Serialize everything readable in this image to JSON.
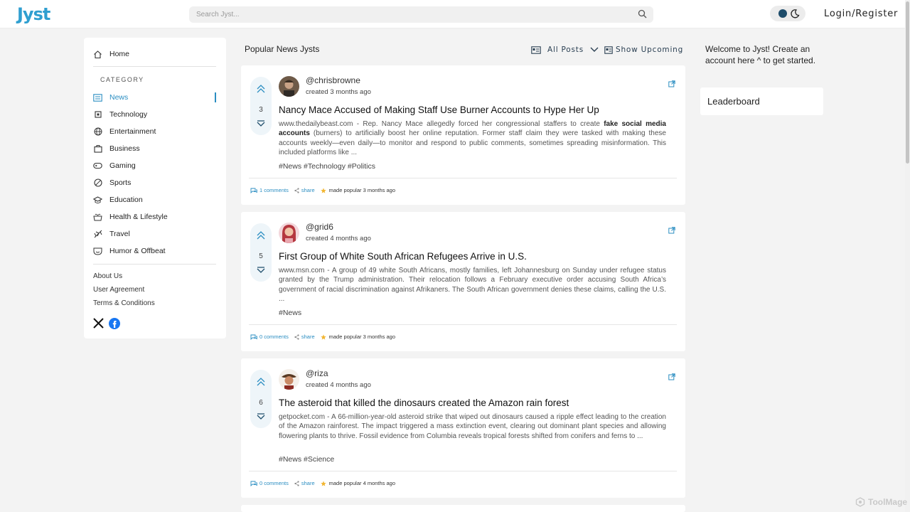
{
  "header": {
    "logo": "Jyst",
    "search_placeholder": "Search Jyst...",
    "login": "Login/Register"
  },
  "sidebar": {
    "home": "Home",
    "category_label": "CATEGORY",
    "categories": [
      {
        "label": "News",
        "icon": "newspaper-icon",
        "active": true
      },
      {
        "label": "Technology",
        "icon": "chip-icon"
      },
      {
        "label": "Entertainment",
        "icon": "globe-icon"
      },
      {
        "label": "Business",
        "icon": "briefcase-icon"
      },
      {
        "label": "Gaming",
        "icon": "gamepad-icon"
      },
      {
        "label": "Sports",
        "icon": "ball-icon"
      },
      {
        "label": "Education",
        "icon": "graduation-cap-icon"
      },
      {
        "label": "Health & Lifestyle",
        "icon": "heart-pot-icon"
      },
      {
        "label": "Travel",
        "icon": "plane-icon"
      },
      {
        "label": "Humor & Offbeat",
        "icon": "smile-icon"
      }
    ],
    "about": "About Us",
    "agreement": "User Agreement",
    "terms": "Terms & Conditions"
  },
  "main": {
    "title": "Popular News Jysts",
    "filter_label": "All Posts",
    "upcoming_label": "Show Upcoming",
    "posts": [
      {
        "votes": "3",
        "username": "@chrisbrowne",
        "created": "created 3 months ago",
        "title": "Nancy Mace Accused of Making Staff Use Burner Accounts to Hype Her Up",
        "body_pre": "www.thedailybeast.com - Rep. Nancy Mace allegedly forced her congressional staffers to create ",
        "body_bold": "fake social media accounts",
        "body_post": " (burners) to artificially boost her online reputation. Former staff claim they were tasked with making these accounts weekly—even daily—to monitor and respond to public comments, sometimes spreading misinformation. This included platforms like ...",
        "tags": "#News #Technology #Politics",
        "comments": "1 comments",
        "share": "share",
        "popular": "made popular 3 months ago"
      },
      {
        "votes": "5",
        "username": "@grid6",
        "created": "created 4 months ago",
        "title": "First Group of White South African Refugees Arrive in U.S.",
        "body_pre": "www.msn.com - A group of 49 white South Africans, mostly families, left Johannesburg on Sunday under refugee status granted by the Trump administration. Their relocation follows a February executive order accusing South Africa’s government of racial discrimination against Afrikaners. The South African government denies these claims, calling the U.S. ...",
        "body_bold": "",
        "body_post": "",
        "tags": "#News",
        "comments": "0 comments",
        "share": "share",
        "popular": "made popular 3 months ago"
      },
      {
        "votes": "6",
        "username": "@riza",
        "created": "created 4 months ago",
        "title": "The asteroid that killed the dinosaurs created the Amazon rain forest",
        "body_pre": "getpocket.com - A 66-million-year-old asteroid strike that wiped out dinosaurs caused a ripple effect leading to the creation of the Amazon rainforest. The impact triggered a mass extinction event, clearing out dominant plant species and allowing flowering plants to thrive. Fossil evidence from Columbia reveals tropical forests shifted from conifers and ferns to ...",
        "body_bold": "",
        "body_post": "",
        "tags": "#News #Science",
        "comments": "0 comments",
        "share": "share",
        "popular": "made popular 4 months ago"
      }
    ]
  },
  "right": {
    "welcome": "Welcome to Jyst! Create an account here ^ to get started.",
    "leaderboard": "Leaderboard"
  },
  "watermark": "ToolMage",
  "colors": {
    "accent": "#2b8ec2",
    "logo": "#2f9fd0",
    "background": "#f3f3f3"
  }
}
